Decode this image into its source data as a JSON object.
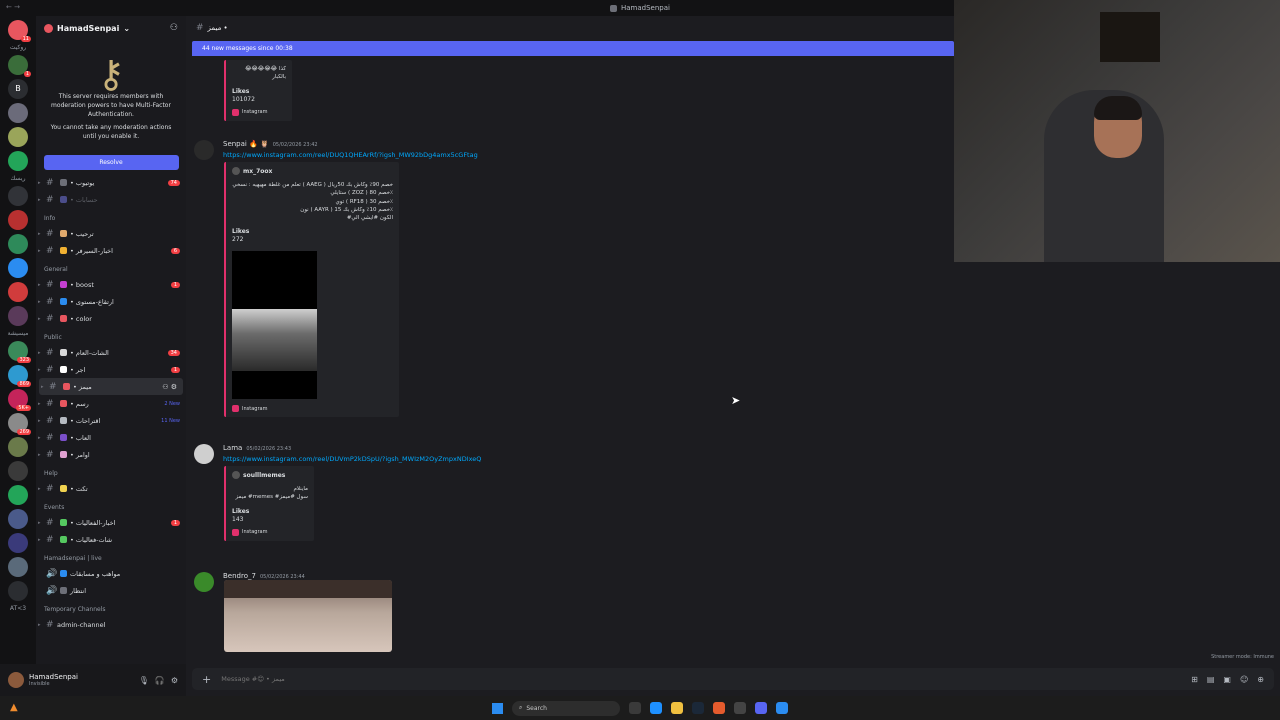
{
  "window": {
    "title": "HamadSenpai",
    "nav": "← →"
  },
  "server": {
    "name": "HamadSenpai",
    "add_icon": "person-add-icon"
  },
  "mfa_notice": {
    "line1": "This server requires members with moderation powers to have Multi-Factor Authentication.",
    "line2": "You cannot take any moderation actions until you enable it.",
    "resolve_label": "Resolve"
  },
  "guild_labels": {
    "g1": "روكيت",
    "g2": "B",
    "g3": "ريسك",
    "g4": "ميسيشة",
    "g5": "AT<3"
  },
  "channels_top": [
    {
      "name": "• يوتيوب",
      "badge": "74",
      "emoji_color": "#6d6f78"
    },
    {
      "name": "• حسابات",
      "muted": true,
      "emoji_color": "#4b4d8a"
    }
  ],
  "categories": {
    "info": "Info",
    "general": "General",
    "public": "Public",
    "help": "Help",
    "events": "Events",
    "live": "Hamadsenpai | live",
    "temp": "Temporary Channels"
  },
  "info_channels": [
    {
      "name": "• ترحيب",
      "emoji_color": "#e0a96d"
    },
    {
      "name": "• اخبار-السيرفر",
      "badge": "6",
      "emoji_color": "#f0b132"
    }
  ],
  "general_channels": [
    {
      "name": "• boost",
      "badge": "1",
      "emoji_color": "#c43fd1"
    },
    {
      "name": "• ارتقاع-مستوى",
      "emoji_color": "#2b8cf0"
    },
    {
      "name": "• color",
      "emoji_color": "#e8565f"
    }
  ],
  "public_channels": [
    {
      "name": "• الشات-العام",
      "badge": "34",
      "emoji_color": "#d9d9d9"
    },
    {
      "name": "• اجر",
      "badge": "1",
      "emoji_color": "#ffffff"
    },
    {
      "name": "• ميمز",
      "active": true,
      "emoji_color": "#e8565f"
    },
    {
      "name": "• رسم",
      "new": "2 New",
      "emoji_color": "#e8565f"
    },
    {
      "name": "• اقتراحات",
      "new": "11 New",
      "emoji_color": "#b5bac1"
    },
    {
      "name": "• العاب",
      "emoji_color": "#7a4fc9"
    },
    {
      "name": "• اوامر",
      "emoji_color": "#e0a0d0"
    }
  ],
  "help_channels": [
    {
      "name": "• تكت",
      "emoji_color": "#f0d250"
    }
  ],
  "event_channels": [
    {
      "name": "• اخبار-الفعاليات",
      "badge": "1",
      "emoji_color": "#55c860"
    },
    {
      "name": "• شات-فعاليات",
      "emoji_color": "#55c860"
    }
  ],
  "live_channels": [
    {
      "name": "مواهب و مسابقات",
      "emoji_color": "#2b8cf0"
    },
    {
      "name": "انتظار",
      "emoji_color": "#6d6f78"
    }
  ],
  "temp_channels": [
    {
      "name": "admin-channel"
    }
  ],
  "user": {
    "name": "HamadSenpai",
    "status": "Invisible"
  },
  "channel_header": {
    "name": "ميمز •"
  },
  "new_messages_bar": "44 new messages since 00:38",
  "messages": {
    "m0": {
      "embed_text": "كذا 😂😂😂😂😂 بالكبار",
      "field_name": "Likes",
      "field_value": "101072",
      "footer": "Instagram"
    },
    "m1": {
      "author": "Senpai 🔥 🦉",
      "timestamp": "05/02/2026 23:42",
      "link": "https://www.instagram.com/reel/DUQ1QHEArRf/?igsh_MW92bDg4amx5cGFtag",
      "embed_author": "mx_7oox",
      "embed_desc": "تعلم من غلطة مهيهيه : نسخي ( AAEG ) خصم 90٪ وكاش بك 50ريال\nستايلي ( ZOZ ) خصم 80٪\nتوي ( RF18 ) خصم 30٪\nنون ( AAYR ) خصم 10٪ وكاش بك 15٪\n#الكون #ايشي الي",
      "field_name": "Likes",
      "field_value": "272",
      "footer": "Instagram"
    },
    "m2": {
      "author": "Lama",
      "timestamp": "05/02/2026 23:43",
      "link": "https://www.instagram.com/reel/DUVmP2kDSpU/?igsh_MWIzM2OyZmpxNDIxeQ",
      "embed_author": "soulllmemes",
      "embed_desc": "ماينلام\nميمز #memes #سول #ميمز",
      "field_name": "Likes",
      "field_value": "143",
      "footer": "Instagram"
    },
    "m3": {
      "author": "Bendro_7",
      "timestamp": "05/02/2026 23:44"
    }
  },
  "input": {
    "placeholder": "Message #😊 • ميمز"
  },
  "streamer_mode": "Streamer mode: Immune",
  "taskbar": {
    "search_placeholder": "Search"
  }
}
